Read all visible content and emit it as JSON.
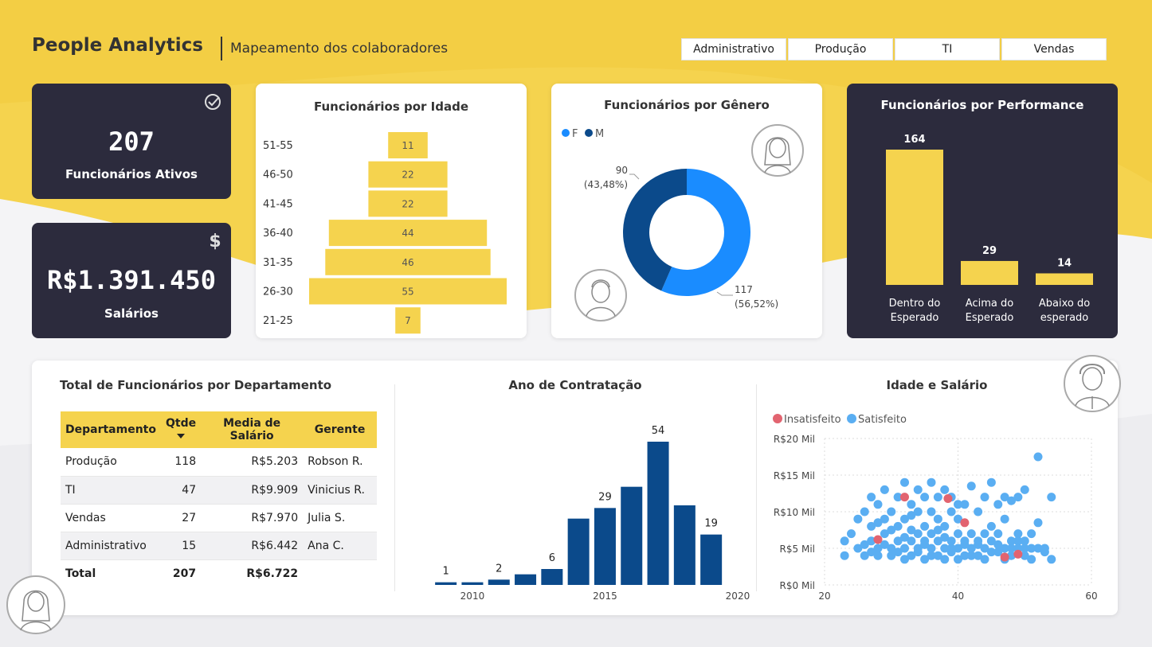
{
  "header": {
    "title": "People Analytics",
    "subtitle": "Mapeamento dos colaboradores"
  },
  "filters": [
    "Administrativo",
    "Produção",
    "TI",
    "Vendas"
  ],
  "kpis": {
    "active": {
      "value": "207",
      "label": "Funcionários Ativos",
      "icon": "check-circle-icon"
    },
    "salaries": {
      "value": "R$1.391.450",
      "label": "Salários",
      "icon": "dollar-icon"
    }
  },
  "colors": {
    "yellow": "#f5d34e",
    "dark": "#2c2b3d",
    "navy": "#0b4a8b",
    "blue": "#1a8cff",
    "scatter_blue": "#5aaef2",
    "scatter_red": "#e26470"
  },
  "chart_data": [
    {
      "id": "age",
      "type": "bar",
      "orientation": "horizontal",
      "title": "Funcionários por Idade",
      "categories": [
        "51-55",
        "46-50",
        "41-45",
        "36-40",
        "31-35",
        "26-30",
        "21-25"
      ],
      "values": [
        11,
        22,
        22,
        44,
        46,
        55,
        7
      ]
    },
    {
      "id": "gender",
      "type": "pie",
      "donut": true,
      "title": "Funcionários por Gênero",
      "legend": [
        "F",
        "M"
      ],
      "slices": [
        {
          "name": "F",
          "value": 117,
          "label": "117",
          "pct": "(56,52%)"
        },
        {
          "name": "M",
          "value": 90,
          "label": "90",
          "pct": "(43,48%)"
        }
      ]
    },
    {
      "id": "performance",
      "type": "bar",
      "title": "Funcionários por Performance",
      "categories": [
        [
          "Dentro do",
          "Esperado"
        ],
        [
          "Acima do",
          "Esperado"
        ],
        [
          "Abaixo do",
          "esperado"
        ]
      ],
      "values": [
        164,
        29,
        14
      ]
    },
    {
      "id": "departments",
      "type": "table",
      "title": "Total de Funcionários por Departamento",
      "columns": [
        "Departamento",
        "Qtde",
        "Media de Salário",
        "Gerente"
      ],
      "rows": [
        [
          "Produção",
          "118",
          "R$5.203",
          "Robson R."
        ],
        [
          "TI",
          "47",
          "R$9.909",
          "Vinicius R."
        ],
        [
          "Vendas",
          "27",
          "R$7.970",
          "Julia S."
        ],
        [
          "Administrativo",
          "15",
          "R$6.442",
          "Ana C."
        ]
      ],
      "total": [
        "Total",
        "207",
        "R$6.722",
        ""
      ]
    },
    {
      "id": "hiring",
      "type": "bar",
      "title": "Ano de Contratação",
      "x": [
        2009,
        2010,
        2011,
        2012,
        2013,
        2014,
        2015,
        2016,
        2017,
        2018,
        2019
      ],
      "values": [
        1,
        1,
        2,
        4,
        6,
        25,
        29,
        37,
        54,
        30,
        19
      ],
      "shown_labels": {
        "2009": "1",
        "2011": "2",
        "2013": "6",
        "2015": "29",
        "2017": "54",
        "2019": "19"
      },
      "xticks": [
        2010,
        2015,
        2020
      ],
      "xlim": [
        2008.5,
        2020
      ]
    },
    {
      "id": "scatter",
      "type": "scatter",
      "title": "Idade e Salário",
      "legend": [
        "Insatisfeito",
        "Satisfeito"
      ],
      "xticks": [
        20,
        40,
        60
      ],
      "yticks": [
        "R$0 Mil",
        "R$5 Mil",
        "R$10 Mil",
        "R$15 Mil",
        "R$20 Mil"
      ],
      "xlim": [
        20,
        60
      ],
      "ylim": [
        0,
        20
      ],
      "series": [
        {
          "name": "Insatisfeito",
          "points": [
            [
              28,
              6.2
            ],
            [
              32,
              12
            ],
            [
              38.5,
              11.8
            ],
            [
              41,
              8.5
            ],
            [
              47,
              3.8
            ],
            [
              49,
              4.2
            ]
          ]
        },
        {
          "name": "Satisfeito",
          "points": [
            [
              23,
              6
            ],
            [
              23,
              4
            ],
            [
              24,
              7
            ],
            [
              25,
              5
            ],
            [
              25,
              9
            ],
            [
              26,
              10
            ],
            [
              26,
              4
            ],
            [
              27,
              6
            ],
            [
              27,
              12
            ],
            [
              27,
              8
            ],
            [
              28,
              5
            ],
            [
              28,
              11
            ],
            [
              28,
              4
            ],
            [
              29,
              7
            ],
            [
              29,
              9
            ],
            [
              29,
              13
            ],
            [
              30,
              5
            ],
            [
              30,
              4
            ],
            [
              30,
              10
            ],
            [
              31,
              6
            ],
            [
              31,
              8
            ],
            [
              31,
              12
            ],
            [
              32,
              5
            ],
            [
              32,
              3.5
            ],
            [
              32,
              9
            ],
            [
              32,
              14
            ],
            [
              33,
              6
            ],
            [
              33,
              4
            ],
            [
              33,
              11
            ],
            [
              33,
              7.5
            ],
            [
              34,
              5
            ],
            [
              34,
              10
            ],
            [
              34,
              4.5
            ],
            [
              34,
              13
            ],
            [
              35,
              6
            ],
            [
              35,
              8
            ],
            [
              35,
              3.5
            ],
            [
              35,
              12
            ],
            [
              36,
              5
            ],
            [
              36,
              7
            ],
            [
              36,
              10
            ],
            [
              36,
              14
            ],
            [
              37,
              4
            ],
            [
              37,
              6
            ],
            [
              37,
              9
            ],
            [
              37,
              12
            ],
            [
              38,
              5
            ],
            [
              38,
              3.5
            ],
            [
              38,
              8
            ],
            [
              38,
              13
            ],
            [
              39,
              6
            ],
            [
              39,
              4.5
            ],
            [
              39,
              10
            ],
            [
              39,
              12
            ],
            [
              40,
              5
            ],
            [
              40,
              7
            ],
            [
              40,
              3.5
            ],
            [
              40,
              9
            ],
            [
              41,
              6
            ],
            [
              41,
              4
            ],
            [
              41,
              11
            ],
            [
              42,
              5
            ],
            [
              42,
              7
            ],
            [
              42,
              13.5
            ],
            [
              43,
              4
            ],
            [
              43,
              6
            ],
            [
              43,
              10
            ],
            [
              44,
              5
            ],
            [
              44,
              12
            ],
            [
              44,
              3.5
            ],
            [
              45,
              6
            ],
            [
              45,
              8
            ],
            [
              45,
              14
            ],
            [
              46,
              4.5
            ],
            [
              46,
              7
            ],
            [
              46,
              11
            ],
            [
              47,
              5
            ],
            [
              47,
              9
            ],
            [
              47,
              12
            ],
            [
              48,
              4
            ],
            [
              48,
              6
            ],
            [
              48,
              11.5
            ],
            [
              49,
              5
            ],
            [
              49,
              7
            ],
            [
              49,
              12
            ],
            [
              50,
              4
            ],
            [
              50,
              6
            ],
            [
              50,
              13
            ],
            [
              51,
              5
            ],
            [
              51,
              3.5
            ],
            [
              51,
              7
            ],
            [
              52,
              5
            ],
            [
              52,
              8.5
            ],
            [
              52,
              17.5
            ],
            [
              53,
              5
            ],
            [
              53,
              4.5
            ],
            [
              54,
              12
            ],
            [
              54,
              3.5
            ],
            [
              26,
              5.5
            ],
            [
              27,
              4.5
            ],
            [
              28,
              8.5
            ],
            [
              29,
              5.5
            ],
            [
              30,
              7.5
            ],
            [
              31,
              4.5
            ],
            [
              32,
              6.5
            ],
            [
              33,
              9.5
            ],
            [
              34,
              7
            ],
            [
              35,
              5.5
            ],
            [
              36,
              4
            ],
            [
              37,
              7.5
            ],
            [
              38,
              6.5
            ],
            [
              39,
              5
            ],
            [
              40,
              11
            ],
            [
              41,
              5.5
            ],
            [
              42,
              4
            ],
            [
              43,
              5.5
            ],
            [
              44,
              7
            ],
            [
              45,
              4.5
            ],
            [
              46,
              5.5
            ],
            [
              47,
              3.5
            ],
            [
              48,
              5
            ],
            [
              49,
              6
            ],
            [
              50,
              5
            ]
          ]
        }
      ]
    }
  ]
}
